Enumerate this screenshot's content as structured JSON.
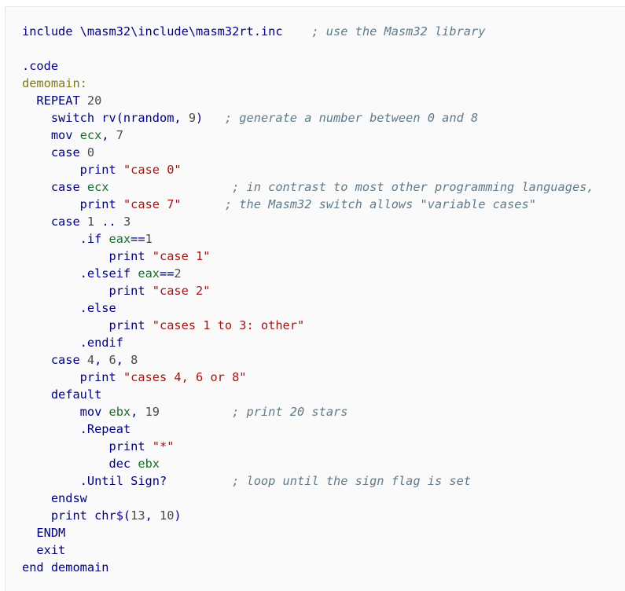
{
  "code": {
    "lines": [
      [
        {
          "t": "include \\masm32\\include\\masm32rt.inc    ",
          "c": "kw"
        },
        {
          "t": "; use the Masm32 library",
          "c": "cmt"
        }
      ],
      [],
      [
        {
          "t": ".code",
          "c": "kw"
        }
      ],
      [
        {
          "t": "demomain:",
          "c": "lbl"
        }
      ],
      [
        {
          "t": "  REPEAT ",
          "c": "kw"
        },
        {
          "t": "20",
          "c": "num"
        }
      ],
      [
        {
          "t": "    switch rv(nrandom, ",
          "c": "kw"
        },
        {
          "t": "9",
          "c": "num"
        },
        {
          "t": ")   ",
          "c": "kw"
        },
        {
          "t": "; generate a number between 0 and 8",
          "c": "cmt"
        }
      ],
      [
        {
          "t": "    mov ",
          "c": "kw"
        },
        {
          "t": "ecx",
          "c": "reg"
        },
        {
          "t": ", ",
          "c": "kw"
        },
        {
          "t": "7",
          "c": "num"
        }
      ],
      [
        {
          "t": "    case ",
          "c": "kw"
        },
        {
          "t": "0",
          "c": "num"
        }
      ],
      [
        {
          "t": "        print ",
          "c": "kw"
        },
        {
          "t": "\"case 0\"",
          "c": "str"
        }
      ],
      [
        {
          "t": "    case ",
          "c": "kw"
        },
        {
          "t": "ecx",
          "c": "reg"
        },
        {
          "t": "                 ",
          "c": "kw"
        },
        {
          "t": "; in contrast to most other programming languages,",
          "c": "cmt"
        }
      ],
      [
        {
          "t": "        print ",
          "c": "kw"
        },
        {
          "t": "\"case 7\"",
          "c": "str"
        },
        {
          "t": "      ",
          "c": "kw"
        },
        {
          "t": "; the Masm32 switch allows \"variable cases\"",
          "c": "cmt"
        }
      ],
      [
        {
          "t": "    case ",
          "c": "kw"
        },
        {
          "t": "1",
          "c": "num"
        },
        {
          "t": " .. ",
          "c": "kw"
        },
        {
          "t": "3",
          "c": "num"
        }
      ],
      [
        {
          "t": "        .if ",
          "c": "kw"
        },
        {
          "t": "eax",
          "c": "reg"
        },
        {
          "t": "==",
          "c": "kw"
        },
        {
          "t": "1",
          "c": "num"
        }
      ],
      [
        {
          "t": "            print ",
          "c": "kw"
        },
        {
          "t": "\"case 1\"",
          "c": "str"
        }
      ],
      [
        {
          "t": "        .elseif ",
          "c": "kw"
        },
        {
          "t": "eax",
          "c": "reg"
        },
        {
          "t": "==",
          "c": "kw"
        },
        {
          "t": "2",
          "c": "num"
        }
      ],
      [
        {
          "t": "            print ",
          "c": "kw"
        },
        {
          "t": "\"case 2\"",
          "c": "str"
        }
      ],
      [
        {
          "t": "        .else",
          "c": "kw"
        }
      ],
      [
        {
          "t": "            print ",
          "c": "kw"
        },
        {
          "t": "\"cases 1 to 3: other\"",
          "c": "str"
        }
      ],
      [
        {
          "t": "        .endif",
          "c": "kw"
        }
      ],
      [
        {
          "t": "    case ",
          "c": "kw"
        },
        {
          "t": "4",
          "c": "num"
        },
        {
          "t": ", ",
          "c": "kw"
        },
        {
          "t": "6",
          "c": "num"
        },
        {
          "t": ", ",
          "c": "kw"
        },
        {
          "t": "8",
          "c": "num"
        }
      ],
      [
        {
          "t": "        print ",
          "c": "kw"
        },
        {
          "t": "\"cases 4, 6 or 8\"",
          "c": "str"
        }
      ],
      [
        {
          "t": "    default",
          "c": "kw"
        }
      ],
      [
        {
          "t": "        mov ",
          "c": "kw"
        },
        {
          "t": "ebx",
          "c": "reg"
        },
        {
          "t": ", ",
          "c": "kw"
        },
        {
          "t": "19",
          "c": "num"
        },
        {
          "t": "          ",
          "c": "kw"
        },
        {
          "t": "; print 20 stars",
          "c": "cmt"
        }
      ],
      [
        {
          "t": "        .Repeat",
          "c": "kw"
        }
      ],
      [
        {
          "t": "            print ",
          "c": "kw"
        },
        {
          "t": "\"*\"",
          "c": "str"
        }
      ],
      [
        {
          "t": "            dec ",
          "c": "kw"
        },
        {
          "t": "ebx",
          "c": "reg"
        }
      ],
      [
        {
          "t": "        .Until Sign?",
          "c": "kw"
        },
        {
          "t": "         ",
          "c": "kw"
        },
        {
          "t": "; loop until the sign flag is set",
          "c": "cmt"
        }
      ],
      [
        {
          "t": "    endsw",
          "c": "kw"
        }
      ],
      [
        {
          "t": "    print chr$(",
          "c": "kw"
        },
        {
          "t": "13",
          "c": "num"
        },
        {
          "t": ", ",
          "c": "kw"
        },
        {
          "t": "10",
          "c": "num"
        },
        {
          "t": ")",
          "c": "kw"
        }
      ],
      [
        {
          "t": "  ENDM",
          "c": "kw"
        }
      ],
      [
        {
          "t": "  exit",
          "c": "kw"
        }
      ],
      [
        {
          "t": "end demomain",
          "c": "kw"
        }
      ]
    ]
  },
  "colors": {
    "keyword": "#000080",
    "register": "#1c6a2a",
    "number": "#4a4a4a",
    "string": "#a31515",
    "comment": "#5f7a8a",
    "label": "#7a7a1a",
    "background": "#fafafa"
  }
}
